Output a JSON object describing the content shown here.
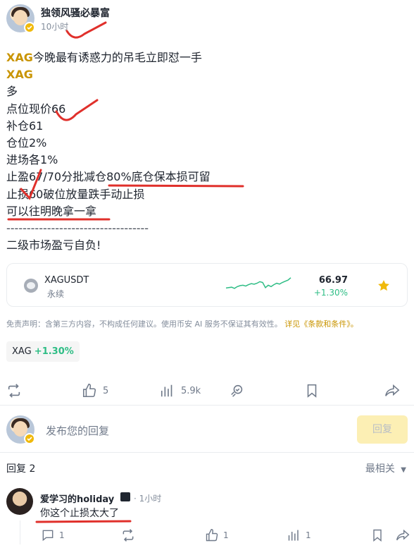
{
  "post": {
    "author": "独领风骚必暴富",
    "time": "10小时",
    "lines": [
      {
        "tick": "XAG",
        "text": "今晚最有诱惑力的吊毛立即怼一手"
      },
      {
        "tick": "XAG",
        "text": ""
      },
      {
        "tick": "",
        "text": "多"
      },
      {
        "tick": "",
        "text": "点位现价66"
      },
      {
        "tick": "",
        "text": "补仓61"
      },
      {
        "tick": "",
        "text": "仓位2%"
      },
      {
        "tick": "",
        "text": "进场各1%"
      },
      {
        "tick": "",
        "text": "止盈67/70分批减仓80%底仓保本损可留"
      },
      {
        "tick": "",
        "text": "止损60破位放量跌手动止损"
      },
      {
        "tick": "",
        "text": "可以往明晚拿一拿"
      },
      {
        "tick": "",
        "text": "-----------------------------------"
      },
      {
        "tick": "",
        "text": "二级市场盈亏自负!"
      }
    ]
  },
  "ticker_card": {
    "symbol": "XAGUSDT",
    "subtitle": "永续",
    "price": "66.97",
    "change": "+1.30%",
    "sparkline": [
      0.38,
      0.4,
      0.42,
      0.36,
      0.45,
      0.5,
      0.52,
      0.48,
      0.55,
      0.6,
      0.57,
      0.62,
      0.7,
      0.66,
      0.4,
      0.52,
      0.45,
      0.55,
      0.62,
      0.58,
      0.66,
      0.72,
      0.78,
      0.9
    ],
    "accent": "#2ebd85",
    "star_color": "#f0b90b",
    "star_icon": "star-icon"
  },
  "disclaimer": {
    "text": "免责声明：含第三方内容，不构成任何建议。使用币安 AI 服务不保证其有效性。",
    "link": "详见《条款和条件》。"
  },
  "tag": {
    "symbol": "XAG",
    "change": "+1.30%"
  },
  "actions": {
    "repost": {
      "icon": "repost-icon",
      "count": ""
    },
    "like": {
      "icon": "thumbs-up-icon",
      "count": "5"
    },
    "views": {
      "icon": "bar-chart-icon",
      "count": "5.9k"
    },
    "tip": {
      "icon": "tip-icon",
      "count": ""
    },
    "bookmark": {
      "icon": "bookmark-icon",
      "count": ""
    },
    "share": {
      "icon": "share-icon",
      "count": ""
    }
  },
  "reply_bar": {
    "placeholder": "发布您的回复",
    "button": "回复"
  },
  "comments": {
    "title": "回复 2",
    "sort": "最相关",
    "items": [
      {
        "name": "爱学习的holiday",
        "time": "· 1小时",
        "text": "你这个止损太大了",
        "replies": "1",
        "likes": "1",
        "views": "1"
      }
    ]
  }
}
